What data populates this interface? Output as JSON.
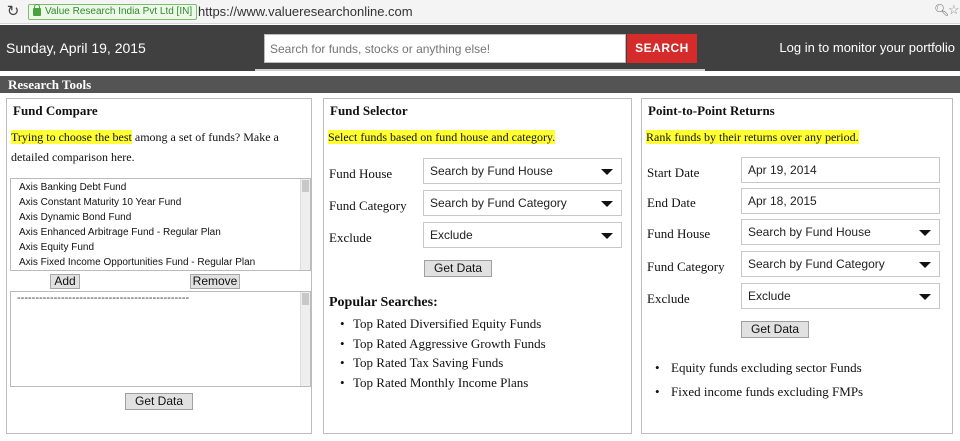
{
  "browser": {
    "secure_label": "Value Research India Pvt Ltd [IN]",
    "url": "https://www.valueresearchonline.com",
    "reload_icon": "reload-icon",
    "zoom_icon": "zoom-icon",
    "star_icon": "star-icon"
  },
  "header": {
    "date": "Sunday, April 19, 2015",
    "search_placeholder": "Search for funds, stocks or anything else!",
    "search_button": "SEARCH",
    "login": "Log in to monitor your portfolio"
  },
  "research_tools": {
    "title": "Research Tools"
  },
  "fund_compare": {
    "title": "Fund Compare",
    "desc_highlight": "Trying to choose the best",
    "desc_rest_line1": " among a set of funds? Make a",
    "desc_line2": "detailed comparison here.",
    "funds": [
      "Axis Banking Debt Fund",
      "Axis Constant Maturity 10 Year Fund",
      "Axis Dynamic Bond Fund",
      "Axis Enhanced Arbitrage Fund - Regular Plan",
      "Axis Equity Fund",
      "Axis Fixed Income Opportunities Fund - Regular Plan"
    ],
    "add_label": "Add",
    "remove_label": "Remove",
    "selected_placeholder": "-----------------------------------------------",
    "get_data": "Get Data"
  },
  "fund_selector": {
    "title": "Fund Selector",
    "desc": "Select funds based on fund house and category.",
    "rows": [
      {
        "label": "Fund House",
        "value": "Search by Fund House"
      },
      {
        "label": "Fund Category",
        "value": "Search by Fund Category"
      },
      {
        "label": "Exclude",
        "value": "Exclude"
      }
    ],
    "get_data": "Get Data",
    "popular_title": "Popular Searches:",
    "popular": [
      "Top Rated Diversified Equity Funds",
      "Top Rated Aggressive Growth Funds",
      "Top Rated Tax Saving Funds",
      "Top Rated Monthly Income Plans"
    ]
  },
  "p2p": {
    "title": "Point-to-Point Returns",
    "desc": "Rank funds by their returns over any period.",
    "start_label": "Start Date",
    "start_value": "Apr 19, 2014",
    "end_label": "End Date",
    "end_value": "Apr 18, 2015",
    "rows": [
      {
        "label": "Fund House",
        "value": "Search by Fund House"
      },
      {
        "label": "Fund Category",
        "value": "Search by Fund Category"
      },
      {
        "label": "Exclude",
        "value": "Exclude"
      }
    ],
    "get_data": "Get Data",
    "links": [
      "Equity funds excluding sector Funds",
      "Fixed income funds excluding FMPs"
    ]
  }
}
